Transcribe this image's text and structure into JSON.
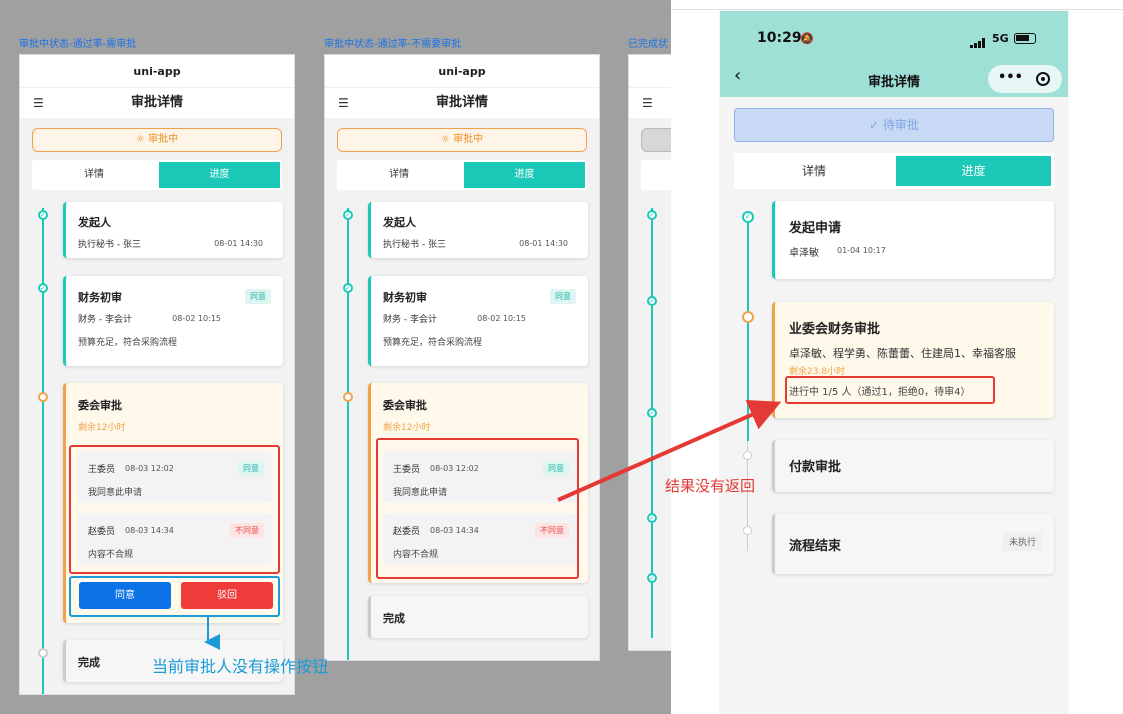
{
  "colors": {
    "teal": "#1cc9b8",
    "orange": "#f0a24a",
    "red": "#e53935",
    "blue": "#1a9bd8",
    "agree_btn": "#0b72e7",
    "reject_btn": "#f03b3b"
  },
  "captions": {
    "left": "审批中状态-通过率-需审批",
    "middle": "审批中状态-通过率-不需要审批",
    "right": "已完成状"
  },
  "app_title": "uni-app",
  "nav_title": "审批详情",
  "menu_icon": "list-icon",
  "status_pending": "☼ 审批中",
  "tabs": {
    "detail": "详情",
    "progress": "进度"
  },
  "steps": {
    "initiator": {
      "title": "发起人",
      "who": "执行秘书 - 张三",
      "time": "08-01 14:30"
    },
    "finance": {
      "title": "财务初审",
      "who": "财务 - 李会计",
      "time": "08-02 10:15",
      "badge": "同意",
      "comment": "预算充足，符合采购流程"
    },
    "committee": {
      "title": "委会审批",
      "remain": "剩余12小时",
      "votes": [
        {
          "name": "王委员",
          "time": "08-03 12:02",
          "badge": "同意",
          "comment": "我同意此申请"
        },
        {
          "name": "赵委员",
          "time": "08-03 14:34",
          "badge": "不同意",
          "comment": "内容不合规"
        }
      ]
    },
    "done": {
      "title": "完成"
    }
  },
  "actions": {
    "agree": "同意",
    "reject": "驳回"
  },
  "annotations": {
    "no_buttons": "当前审批人没有操作按钮",
    "no_result": "结果没有返回"
  },
  "mobile": {
    "clock": "10:29",
    "mute_icon": "bell-slash-icon",
    "network": "5G",
    "title": "审批详情",
    "pending_label": "待审批",
    "tabs": {
      "detail": "详情",
      "progress": "进度"
    },
    "steps": {
      "apply": {
        "title": "发起申请",
        "who": "卓泽敏",
        "time": "01-04 10:17"
      },
      "finance": {
        "title": "业委会财务审批",
        "members": "卓泽敏、程学勇、陈蕾蕾、住建局1、幸福客服",
        "remain": "剩余23.8小时",
        "progress": "进行中 1/5 人（通过1，拒绝0，待审4）"
      },
      "payment": {
        "title": "付款审批"
      },
      "end": {
        "title": "流程结束",
        "badge": "未执行"
      }
    }
  }
}
